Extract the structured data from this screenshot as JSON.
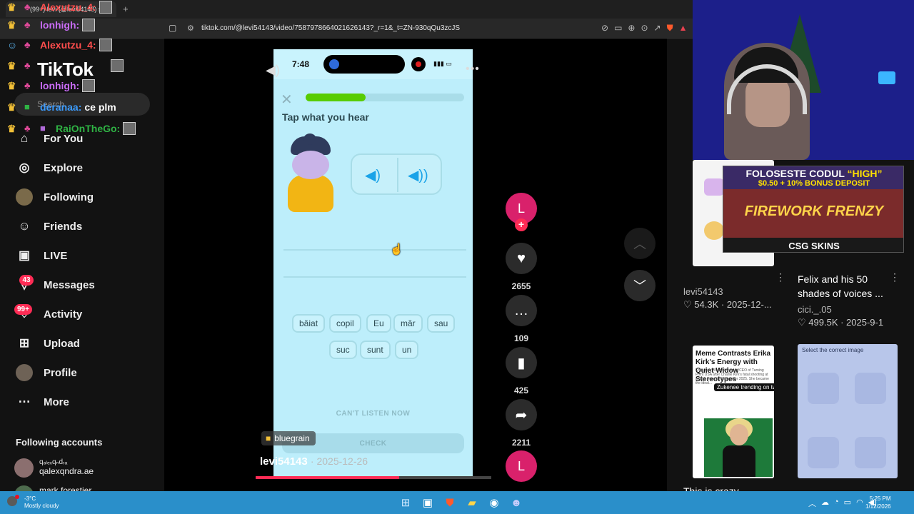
{
  "browser": {
    "tab_title": "(99+) levi (@levi54143) s vid",
    "url": "tiktok.com/@levi54143/video/7587978664021626143?_r=1&_t=ZN-930qQu3zcJS"
  },
  "chat": [
    {
      "user": "Alexutzu_4:",
      "color": "#ff4d4d",
      "msg": ""
    },
    {
      "user": "lonhigh:",
      "color": "#c96cf6",
      "msg": ""
    },
    {
      "user": "Alexutzu_4:",
      "color": "#ff4d4d",
      "msg": ""
    },
    {
      "user": "TikTok",
      "color": "#ffffff",
      "msg": ""
    },
    {
      "user": "lonhigh:",
      "color": "#c96cf6",
      "msg": ""
    },
    {
      "user": "deranaa:",
      "color": "#3c9cff",
      "msg": "ce plm"
    },
    {
      "user": "RaiOnTheGo:",
      "color": "#2fb344",
      "msg": ""
    }
  ],
  "tiktok": {
    "logo": "TikTok",
    "search_placeholder": "Search"
  },
  "sidebar": {
    "items": [
      {
        "label": "For You",
        "icon": "home-icon"
      },
      {
        "label": "Explore",
        "icon": "compass-icon"
      },
      {
        "label": "Following",
        "icon": "avatar-icon"
      },
      {
        "label": "Friends",
        "icon": "friends-icon"
      },
      {
        "label": "LIVE",
        "icon": "live-icon"
      },
      {
        "label": "Messages",
        "icon": "messages-icon",
        "badge": "43"
      },
      {
        "label": "Activity",
        "icon": "activity-icon",
        "badge": "99+"
      },
      {
        "label": "Upload",
        "icon": "upload-icon"
      },
      {
        "label": "Profile",
        "icon": "profile-avatar-icon"
      },
      {
        "label": "More",
        "icon": "more-icon"
      }
    ],
    "following_header": "Following accounts",
    "accounts": [
      {
        "display": "qₐₗₑₓqₙdᵣₐ",
        "handle": "qalexqndra.ae"
      },
      {
        "display": "mark forestier",
        "handle": ""
      }
    ]
  },
  "video": {
    "phone_time": "7:48",
    "prompt": "Tap what you hear",
    "progress": 0.38,
    "words_row1": [
      "băiat",
      "copil",
      "Eu",
      "măr",
      "sau"
    ],
    "words_row2": [
      "suc",
      "sunt",
      "un"
    ],
    "cant_listen": "CAN'T LISTEN NOW",
    "check": "CHECK",
    "music_tag": "bluegrain",
    "author": "levi54143",
    "date": "2025-12-26",
    "playback_progress": 0.61
  },
  "actions": {
    "avatar_letter": "L",
    "likes": "2655",
    "comments": "109",
    "saves": "425",
    "shares": "2211"
  },
  "ad": {
    "line1_a": "FOLOSESTE CODUL ",
    "line1_b": "“HIGH”",
    "line2": "$0.50 + 10% BONUS DEPOSIT",
    "art_text": "FIREWORK FRENZY",
    "brand": "CSG SKINS"
  },
  "cards": [
    {
      "title": "",
      "user": "levi54143",
      "likes": "54.3K",
      "date": "2025-12-..."
    },
    {
      "title": "Felix and his 50 shades of voices ...",
      "user": "cici._.05",
      "likes": "499.5K",
      "date": "2025-9-1"
    },
    {
      "title": "This is crazy...",
      "user": "",
      "likes": "",
      "date": ""
    }
  ],
  "thumb_news": {
    "headline": "Meme Contrasts Erika Kirk's Energy with Quiet Widow Stereotypes",
    "body": "Erika Kirk, 36, took over as CEO of Turning Point USA after Charlie Kirk's fatal shooting at a Utah event in September 2025. She became the ideal...",
    "pill": "Zukenee trending on twitter 😂😂"
  },
  "thumb_duo": {
    "header": "Select the correct image"
  },
  "taskbar": {
    "temp": "-3°C",
    "weather": "Mostly cloudy",
    "time": "5:25 PM",
    "date": "1/12/2026"
  }
}
